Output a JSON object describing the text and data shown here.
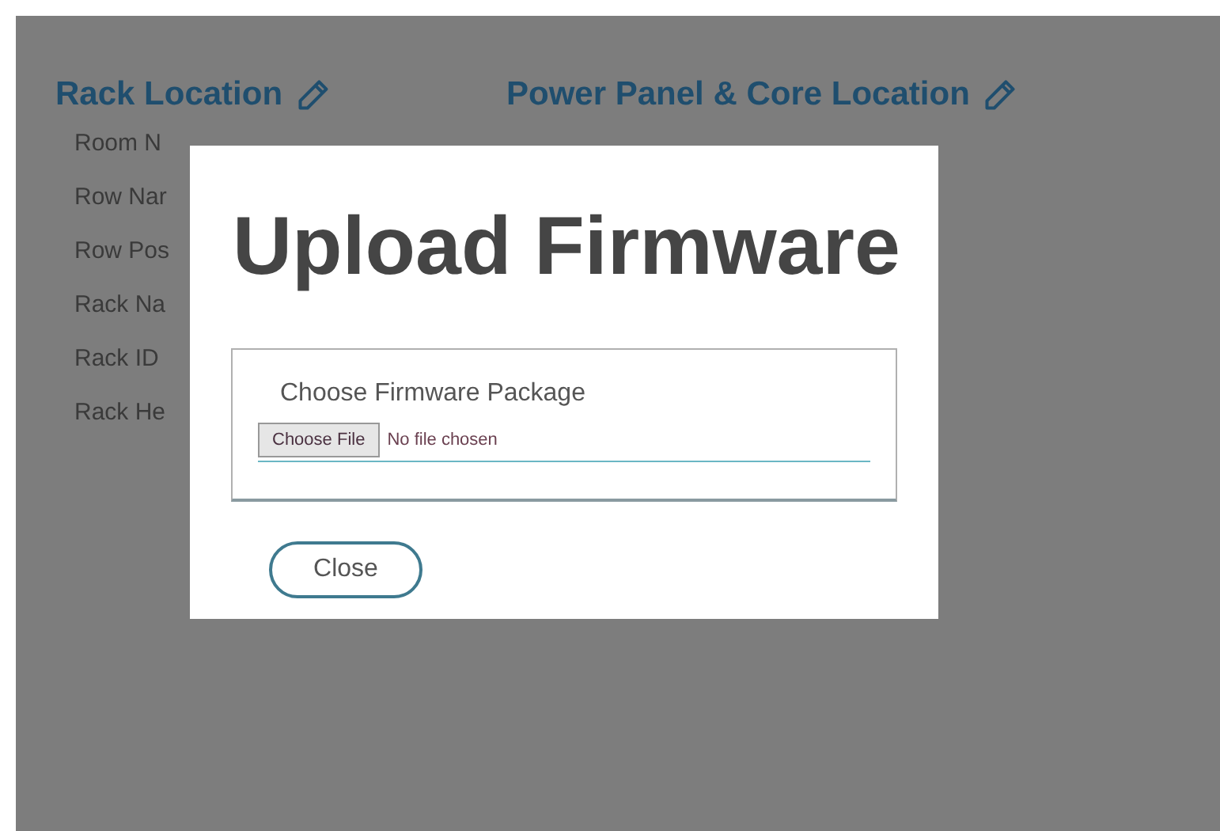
{
  "sections": [
    {
      "title": "Rack Location",
      "fields": [
        "Room N",
        "Row Nar",
        "Row Pos",
        "Rack Na",
        "Rack ID",
        "Rack He"
      ]
    },
    {
      "title": "Power Panel & Core Location"
    }
  ],
  "dialog": {
    "title": "Upload Firmware",
    "file_label": "Choose Firmware Package",
    "file_button": "Choose File",
    "file_status": "No file chosen",
    "close_button": "Close"
  }
}
